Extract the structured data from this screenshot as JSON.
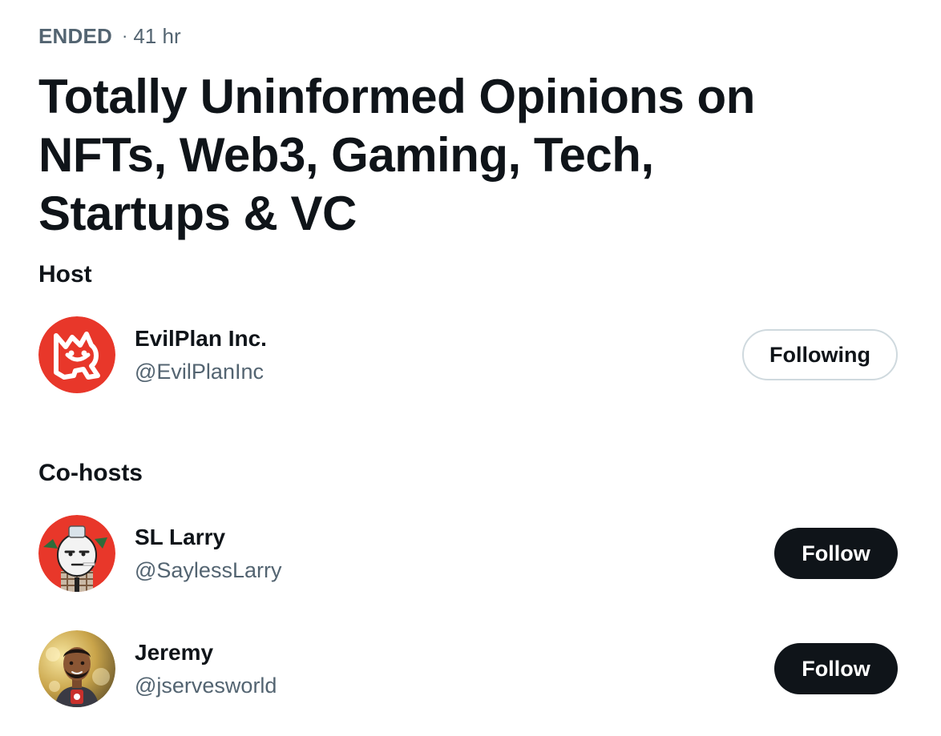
{
  "space": {
    "status": "ENDED",
    "separator": "·",
    "duration": "41 hr",
    "title": "Totally Uninformed Opinions on NFTs, Web3, Gaming, Tech, Startups & VC"
  },
  "host_section": {
    "label": "Host",
    "host": {
      "name": "EvilPlan Inc.",
      "handle": "@EvilPlanInc",
      "button_label": "Following",
      "avatar_icon": "evilplan-logo-icon",
      "avatar_color": "#e8372a"
    }
  },
  "cohost_section": {
    "label": "Co-hosts",
    "cohosts": [
      {
        "name": "SL Larry",
        "handle": "@SaylessLarry",
        "button_label": "Follow",
        "avatar_icon": "cartoon-character-avatar-icon",
        "avatar_color": "#e8372a"
      },
      {
        "name": "Jeremy",
        "handle": "@jservesworld",
        "button_label": "Follow",
        "avatar_icon": "bitmoji-avatar-icon",
        "avatar_color": "#c9a44a"
      }
    ]
  },
  "colors": {
    "text_primary": "#0f1419",
    "text_secondary": "#536471",
    "follow_button_bg": "#0f1419",
    "following_button_border": "#cfd9de"
  }
}
